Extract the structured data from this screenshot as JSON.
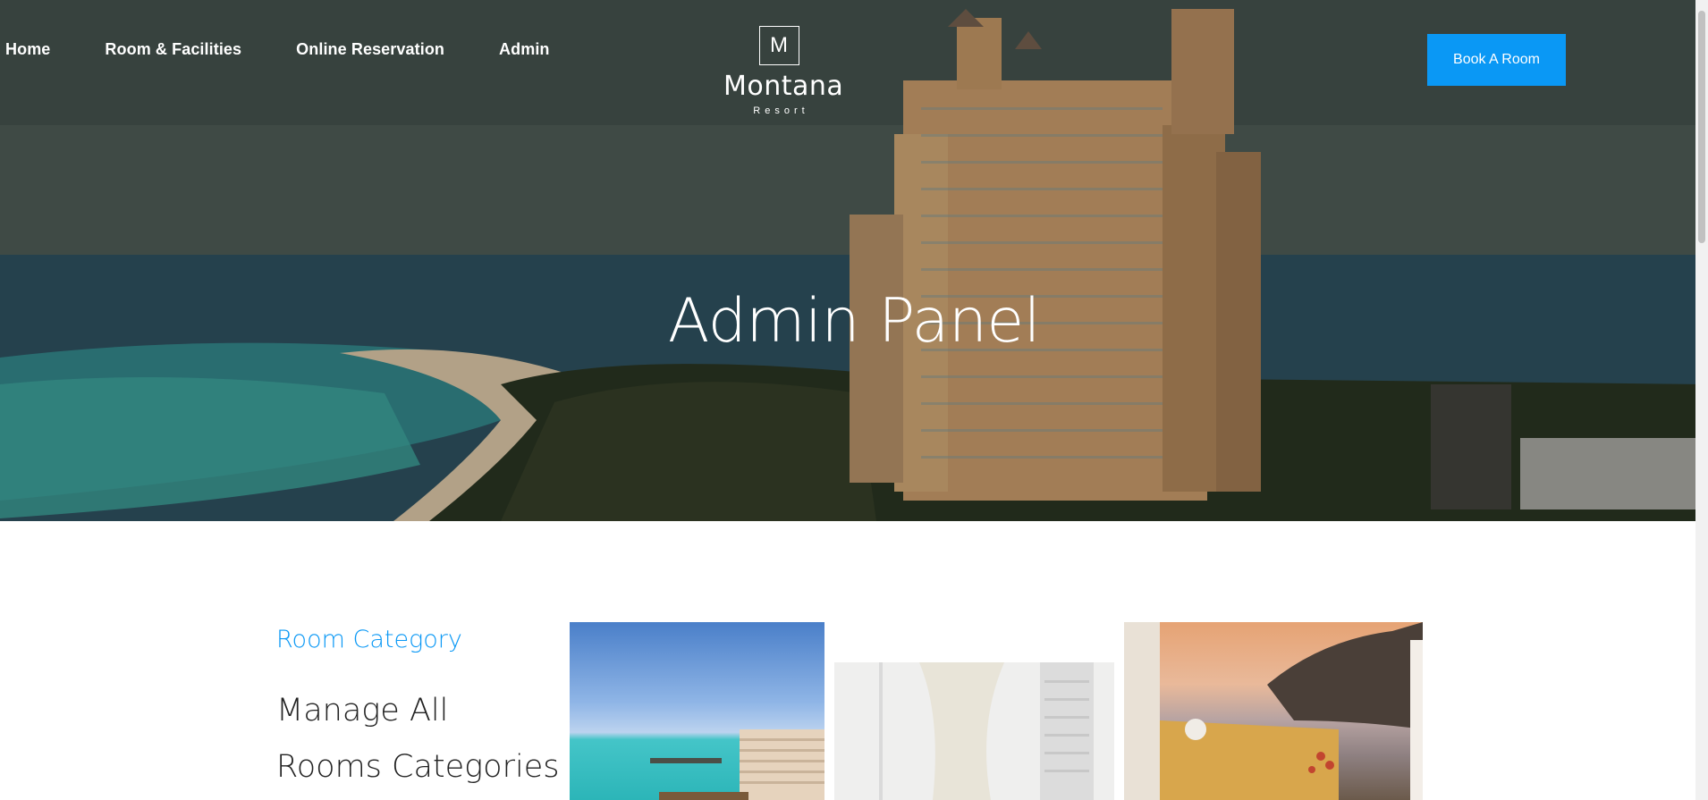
{
  "nav": {
    "items": [
      {
        "label": "Home"
      },
      {
        "label": "Room & Facilities"
      },
      {
        "label": "Online Reservation"
      },
      {
        "label": "Admin"
      }
    ]
  },
  "logo": {
    "mark": "M",
    "name": "Montana",
    "subtitle": "Resort"
  },
  "header": {
    "book_button_label": "Book A Room"
  },
  "hero": {
    "title": "Admin Panel"
  },
  "section": {
    "eyebrow": "Room Category",
    "heading": "Manage All Rooms Categories"
  },
  "colors": {
    "accent": "#0a98f5",
    "text_dark": "#222222"
  }
}
